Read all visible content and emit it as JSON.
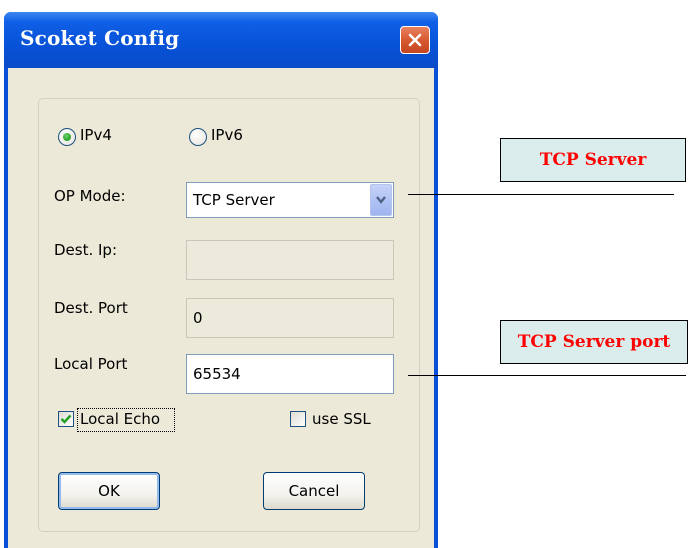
{
  "window": {
    "title": "Scoket Config"
  },
  "ip_version": {
    "ipv4_label": "IPv4",
    "ipv6_label": "IPv6",
    "selected": "IPv4"
  },
  "op_mode": {
    "label": "OP Mode:",
    "value": "TCP Server"
  },
  "dest_ip": {
    "label": "Dest. Ip:",
    "value": ""
  },
  "dest_port": {
    "label": "Dest. Port",
    "value": "0"
  },
  "local_port": {
    "label": "Local Port",
    "value": "65534"
  },
  "local_echo": {
    "label": "Local Echo",
    "checked": true
  },
  "use_ssl": {
    "label": "use SSL",
    "checked": false
  },
  "buttons": {
    "ok": "OK",
    "cancel": "Cancel"
  },
  "annotations": {
    "tcp_server": "TCP Server",
    "tcp_server_port": "TCP Server port"
  },
  "colors": {
    "title_bar": "#0752d7",
    "dialog_bg": "#ece9d8",
    "annotation_text": "#ff0000",
    "annotation_bg": "#daecec"
  }
}
